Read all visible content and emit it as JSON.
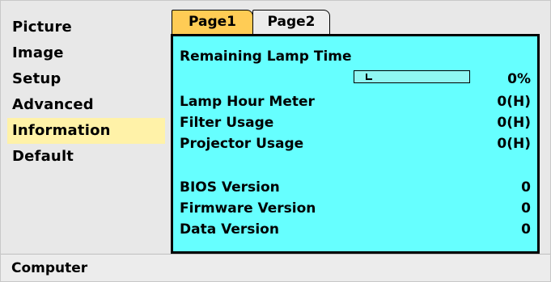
{
  "menu": {
    "items": [
      {
        "label": "Picture"
      },
      {
        "label": "Image"
      },
      {
        "label": "Setup"
      },
      {
        "label": "Advanced"
      },
      {
        "label": "Information"
      },
      {
        "label": "Default"
      }
    ],
    "active_index": 4
  },
  "tabs": [
    {
      "label": "Page1",
      "active": true
    },
    {
      "label": "Page2",
      "active": false
    }
  ],
  "info": {
    "remaining_lamp_time_label": "Remaining Lamp Time",
    "remaining_lamp_time_percent": "0%",
    "lamp_progress_fraction": 0,
    "lamp_hour_meter_label": "Lamp Hour Meter",
    "lamp_hour_meter_value": "0(H)",
    "filter_usage_label": "Filter Usage",
    "filter_usage_value": "0(H)",
    "projector_usage_label": "Projector Usage",
    "projector_usage_value": "0(H)",
    "bios_version_label": "BIOS Version",
    "bios_version_value": "0",
    "firmware_version_label": "Firmware Version",
    "firmware_version_value": "0",
    "data_version_label": "Data Version",
    "data_version_value": "0"
  },
  "footer": {
    "source": "Computer"
  },
  "colors": {
    "content_bg": "#66ffff",
    "active_menu_bg": "#fff2a8",
    "active_tab_bg": "#ffcc55"
  }
}
